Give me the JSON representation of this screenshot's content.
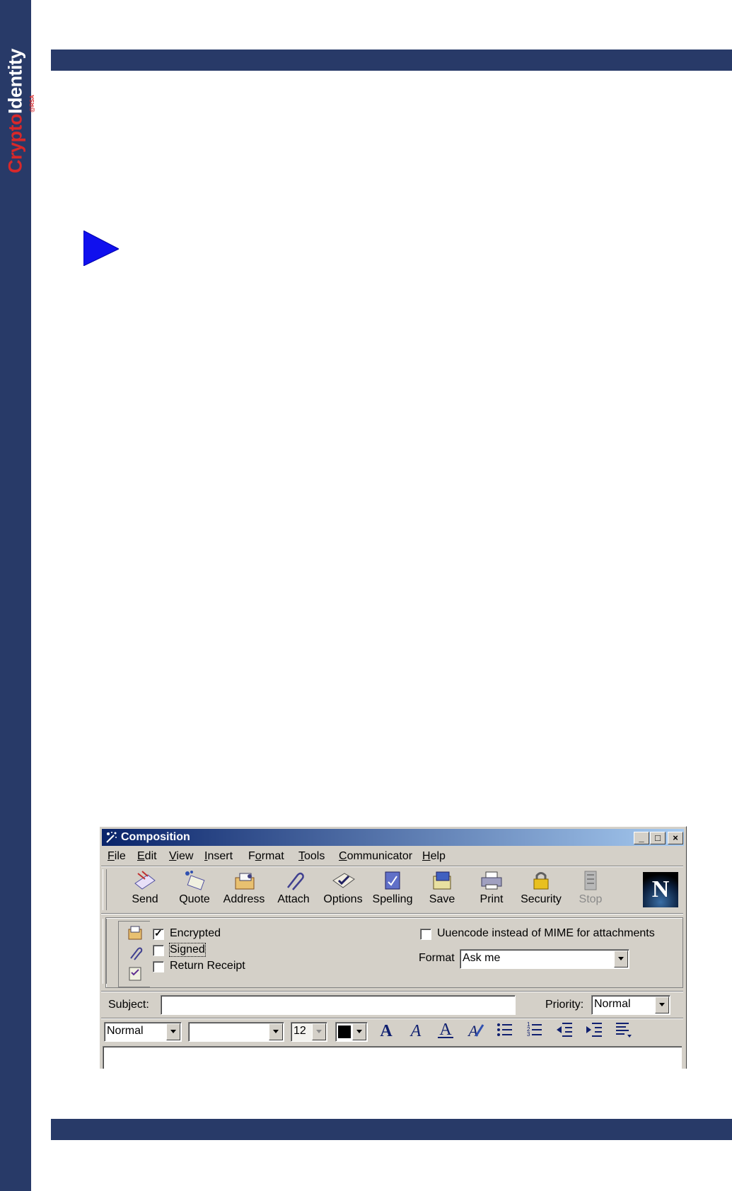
{
  "page": {
    "logo": "CryptoIdentity",
    "logo_parts": [
      "Crypto",
      "Identity"
    ],
    "logo_sub": "@RSA"
  },
  "window": {
    "title": "Composition",
    "title_buttons": [
      "_",
      "□",
      "×"
    ]
  },
  "menu": [
    {
      "label": "File",
      "key": "F"
    },
    {
      "label": "Edit",
      "key": "E"
    },
    {
      "label": "View",
      "key": "V"
    },
    {
      "label": "Insert",
      "key": "I"
    },
    {
      "label": "Format",
      "key": "o"
    },
    {
      "label": "Tools",
      "key": "T"
    },
    {
      "label": "Communicator",
      "key": "C"
    },
    {
      "label": "Help",
      "key": "H"
    }
  ],
  "toolbar": [
    {
      "label": "Send",
      "icon": "send-icon",
      "enabled": true
    },
    {
      "label": "Quote",
      "icon": "quote-icon",
      "enabled": true
    },
    {
      "label": "Address",
      "icon": "address-icon",
      "enabled": true
    },
    {
      "label": "Attach",
      "icon": "attach-icon",
      "enabled": true
    },
    {
      "label": "Options",
      "icon": "options-icon",
      "enabled": true
    },
    {
      "label": "Spelling",
      "icon": "spelling-icon",
      "enabled": true
    },
    {
      "label": "Save",
      "icon": "save-icon",
      "enabled": true
    },
    {
      "label": "Print",
      "icon": "print-icon",
      "enabled": true
    },
    {
      "label": "Security",
      "icon": "security-icon",
      "enabled": true
    },
    {
      "label": "Stop",
      "icon": "stop-icon",
      "enabled": false
    }
  ],
  "toolbar_brand": "N",
  "options": {
    "encrypted": {
      "label": "Encrypted",
      "checked": true
    },
    "signed": {
      "label": "Signed",
      "checked": false
    },
    "return_receipt": {
      "label": "Return Receipt",
      "checked": false
    },
    "uuencode": {
      "label": "Uuencode instead of MIME for attachments",
      "checked": false
    },
    "format_label": "Format",
    "format_value": "Ask me"
  },
  "subject": {
    "label": "Subject:",
    "value": ""
  },
  "priority": {
    "label": "Priority:",
    "value": "Normal"
  },
  "format_bar": {
    "paragraph_style": "Normal",
    "font": "",
    "size": "12",
    "color": "#000000"
  }
}
